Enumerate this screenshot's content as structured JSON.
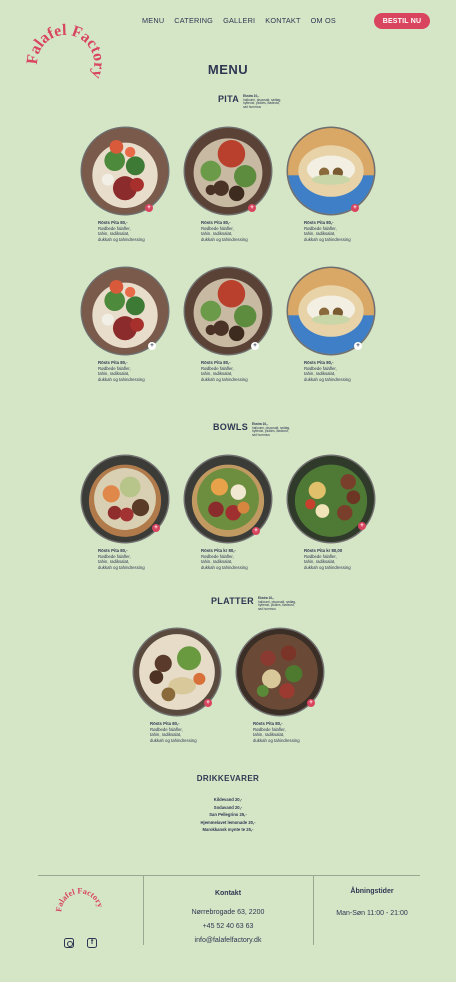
{
  "brand": {
    "logo_text": "Falafel Factory",
    "accent": "#d9455f",
    "background": "#d4e6c6",
    "text_color": "#2e3652"
  },
  "nav": {
    "items": [
      "MENU",
      "CATERING",
      "GALLERI",
      "KONTAKT",
      "OM OS"
    ],
    "order_button": "BESTIL NU"
  },
  "page_title": "MENU",
  "sections": {
    "pita": {
      "title": "PITA",
      "note_head": "Ekstra 10,-",
      "note_body": "halloumi, pisoosalt, rødløg, hytteost, pickles, flødeost, rød hummus"
    },
    "bowls": {
      "title": "BOWLS",
      "note_head": "Ekstra 10,-",
      "note_body": "halloumi, pisoosalt, rødløg, hytteost, pickles, flødeost, rød hummus"
    },
    "platter": {
      "title": "PLATTER",
      "note_head": "Ekstra 10,-",
      "note_body": "halloumi, pisoosalt, rødløg, hytteost, pickles, flødeost, rød hummus"
    }
  },
  "pita_items": [
    {
      "title": "Rösts Pita  80,-",
      "line1": "Rødbede falafler,",
      "line2": "tahin, radiksalat,",
      "line3": "dukkah og tahindressing",
      "badge": "+"
    },
    {
      "title": "Rösts Pita  80,-",
      "line1": "Rødbede falafler,",
      "line2": "tahin, radiksalat,",
      "line3": "dukkah og tahindressing",
      "badge": "+"
    },
    {
      "title": "Rösts Pita  80,-",
      "line1": "Rødbede falafler,",
      "line2": "tahin, radiksalat,",
      "line3": "dukkah og tahindressing",
      "badge": "+"
    },
    {
      "title": "Rösts Pita  80,-",
      "line1": "Rødbede falafler,",
      "line2": "tahin, radiksalat,",
      "line3": "dukkah og tahindressing",
      "badge": "+"
    },
    {
      "title": "Rösts Pita  80,-",
      "line1": "Rødbede falafler,",
      "line2": "tahin, radiksalat,",
      "line3": "dukkah og tahindressing",
      "badge": "+"
    },
    {
      "title": "Rösts Pita  80,-",
      "line1": "Rødbede falafler,",
      "line2": "tahin, radiksalat,",
      "line3": "dukkah og tahindressing",
      "badge": "+"
    }
  ],
  "bowl_items": [
    {
      "title": "Rösts Pita  80,-",
      "line1": "Rødbede falafler,",
      "line2": "tahin, radiksalat,",
      "line3": "dukkah og tahindressing",
      "badge": "+"
    },
    {
      "title": "Rösts Pita  kr 80,-",
      "line1": "Rødbede falafler,",
      "line2": "tahin, radiksalat,",
      "line3": "dukkah og tahindressing",
      "badge": "+"
    },
    {
      "title": "Rösts Pita  kr 80,00",
      "line1": "Rødbede falafler,",
      "line2": "tahin, radiksalat,",
      "line3": "dukkah og tahindressing",
      "badge": "+"
    }
  ],
  "platter_items": [
    {
      "title": "Rösts Pita  80,-",
      "line1": "Rødbede falafler,",
      "line2": "tahin, radiksalat,",
      "line3": "dukkah og tahindressing",
      "badge": "+"
    },
    {
      "title": "Rösts Pita  80,-",
      "line1": "Rødbede falafler,",
      "line2": "tahin, radiksalat,",
      "line3": "dukkah og tahindressing",
      "badge": "+"
    }
  ],
  "drinks": {
    "title": "DRIKKEVARER",
    "items": [
      "Kildevand  20,-",
      "Sodavand  20,-",
      "San Pellegrino  25,-",
      "Hjemmelavet lemonade  30,-",
      "Marokkansk mynte te  25,-"
    ]
  },
  "footer": {
    "contact": {
      "title": "Kontakt",
      "address": "Nørrebrogade 63, 2200",
      "phone": "+45 52 40 63 63",
      "email": "info@falafelfactory.dk"
    },
    "hours": {
      "title": "Åbningstider",
      "value": "Man-Søn 11:00 - 21:00"
    }
  }
}
